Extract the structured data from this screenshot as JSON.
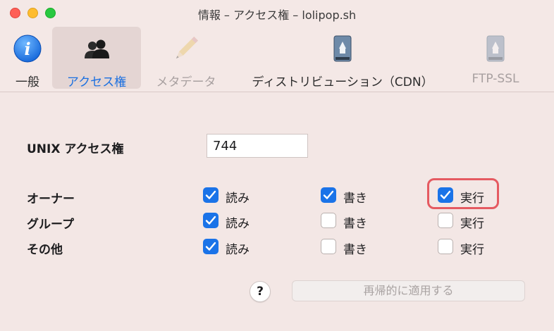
{
  "window": {
    "title": "情報 – アクセス権 – lolipop.sh"
  },
  "toolbar": {
    "tabs": [
      {
        "label": "一般",
        "icon": "info-icon",
        "state": "normal"
      },
      {
        "label": "アクセス権",
        "icon": "users-icon",
        "state": "selected"
      },
      {
        "label": "メタデータ",
        "icon": "pencil-icon",
        "state": "disabled"
      },
      {
        "label": "ディストリビューション（CDN）",
        "icon": "drive-icon",
        "state": "normal"
      },
      {
        "label": "FTP-SSL",
        "icon": "drive-icon",
        "state": "disabled"
      }
    ]
  },
  "permissions": {
    "unix_label": "UNIX アクセス権",
    "unix_value": "744",
    "rows": [
      {
        "label": "オーナー",
        "read": {
          "label": "読み",
          "checked": true
        },
        "write": {
          "label": "書き",
          "checked": true
        },
        "exec": {
          "label": "実行",
          "checked": true
        }
      },
      {
        "label": "グループ",
        "read": {
          "label": "読み",
          "checked": true
        },
        "write": {
          "label": "書き",
          "checked": false
        },
        "exec": {
          "label": "実行",
          "checked": false
        }
      },
      {
        "label": "その他",
        "read": {
          "label": "読み",
          "checked": true
        },
        "write": {
          "label": "書き",
          "checked": false
        },
        "exec": {
          "label": "実行",
          "checked": false
        }
      }
    ]
  },
  "footer": {
    "help_label": "?",
    "apply_label": "再帰的に適用する"
  },
  "colors": {
    "accent": "#1a73e8",
    "highlight": "#e55a61",
    "selected_tab_text": "#1a6fe0"
  }
}
